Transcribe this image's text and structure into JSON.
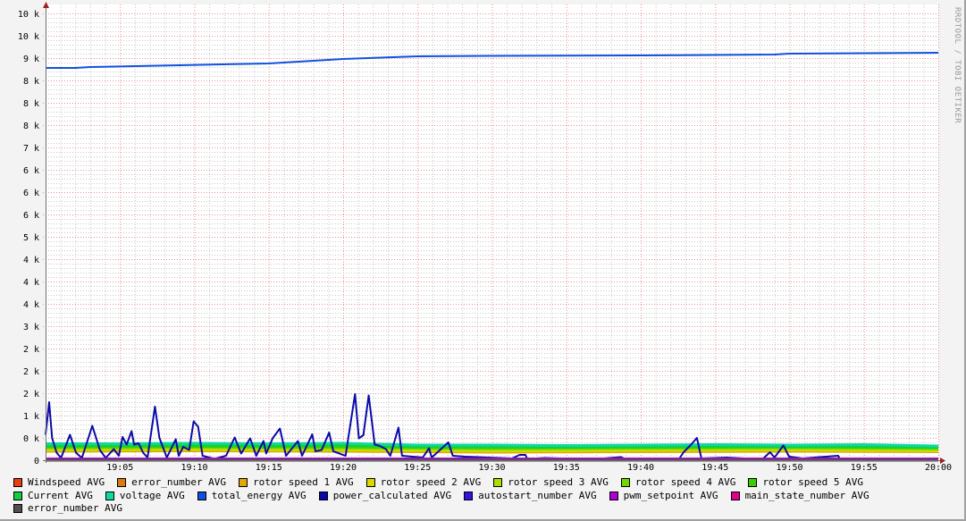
{
  "chart_data": {
    "type": "line",
    "title": "",
    "watermark": "RRDTOOL / TOBI OETIKER",
    "xlabel": "",
    "ylabel": "",
    "x_unit": "minutes after 19:00",
    "xlim": [
      0,
      60
    ],
    "ylim": [
      0,
      10000
    ],
    "grid": true,
    "legend_placement": "bottom",
    "x_ticks": [
      {
        "min": 5,
        "label": "19:05"
      },
      {
        "min": 10,
        "label": "19:10"
      },
      {
        "min": 15,
        "label": "19:15"
      },
      {
        "min": 20,
        "label": "19:20"
      },
      {
        "min": 25,
        "label": "19:25"
      },
      {
        "min": 30,
        "label": "19:30"
      },
      {
        "min": 35,
        "label": "19:35"
      },
      {
        "min": 40,
        "label": "19:40"
      },
      {
        "min": 45,
        "label": "19:45"
      },
      {
        "min": 50,
        "label": "19:50"
      },
      {
        "min": 55,
        "label": "19:55"
      },
      {
        "min": 60,
        "label": "20:00"
      }
    ],
    "y_ticks": [
      {
        "v": 0,
        "label": "0"
      },
      {
        "v": 500,
        "label": "0 k"
      },
      {
        "v": 1000,
        "label": "1 k"
      },
      {
        "v": 1500,
        "label": "2 k"
      },
      {
        "v": 2000,
        "label": "2 k"
      },
      {
        "v": 2500,
        "label": "2 k"
      },
      {
        "v": 3000,
        "label": "3 k"
      },
      {
        "v": 3500,
        "label": "4 k"
      },
      {
        "v": 4000,
        "label": "4 k"
      },
      {
        "v": 4500,
        "label": "4 k"
      },
      {
        "v": 5000,
        "label": "5 k"
      },
      {
        "v": 5500,
        "label": "6 k"
      },
      {
        "v": 6000,
        "label": "6 k"
      },
      {
        "v": 6500,
        "label": "6 k"
      },
      {
        "v": 7000,
        "label": "7 k"
      },
      {
        "v": 7500,
        "label": "8 k"
      },
      {
        "v": 8000,
        "label": "8 k"
      },
      {
        "v": 8500,
        "label": "8 k"
      },
      {
        "v": 9000,
        "label": "9 k"
      },
      {
        "v": 9500,
        "label": "10 k"
      },
      {
        "v": 10000,
        "label": "10 k"
      }
    ],
    "series": [
      {
        "name": "Windspeed AVG",
        "color": "#e8400c",
        "points": [
          [
            0,
            10
          ],
          [
            60,
            10
          ]
        ]
      },
      {
        "name": "error_number AVG",
        "color": "#d87a10",
        "points": [
          [
            0,
            0
          ],
          [
            60,
            0
          ]
        ]
      },
      {
        "name": "rotor speed 1 AVG",
        "color": "#e0a800",
        "points": [
          [
            0,
            200
          ],
          [
            10,
            210
          ],
          [
            20,
            200
          ],
          [
            30,
            180
          ],
          [
            40,
            190
          ],
          [
            50,
            200
          ],
          [
            60,
            190
          ]
        ]
      },
      {
        "name": "rotor speed 2 AVG",
        "color": "#d8d800",
        "points": [
          [
            0,
            230
          ],
          [
            10,
            240
          ],
          [
            20,
            230
          ],
          [
            30,
            210
          ],
          [
            40,
            220
          ],
          [
            50,
            230
          ],
          [
            60,
            210
          ]
        ]
      },
      {
        "name": "rotor speed 3 AVG",
        "color": "#a8e000",
        "points": [
          [
            0,
            260
          ],
          [
            10,
            270
          ],
          [
            20,
            260
          ],
          [
            30,
            240
          ],
          [
            40,
            250
          ],
          [
            50,
            260
          ],
          [
            60,
            240
          ]
        ]
      },
      {
        "name": "rotor speed 4 AVG",
        "color": "#70d800",
        "points": [
          [
            0,
            280
          ],
          [
            10,
            290
          ],
          [
            20,
            280
          ],
          [
            30,
            260
          ],
          [
            40,
            270
          ],
          [
            50,
            280
          ],
          [
            60,
            260
          ]
        ]
      },
      {
        "name": "rotor speed 5 AVG",
        "color": "#38d000",
        "points": [
          [
            0,
            300
          ],
          [
            10,
            310
          ],
          [
            20,
            300
          ],
          [
            30,
            280
          ],
          [
            40,
            290
          ],
          [
            50,
            300
          ],
          [
            60,
            280
          ]
        ]
      },
      {
        "name": "Current AVG",
        "color": "#10d040",
        "points": [
          [
            0,
            320
          ],
          [
            5,
            330
          ],
          [
            10,
            340
          ],
          [
            15,
            330
          ],
          [
            20,
            340
          ],
          [
            25,
            300
          ],
          [
            30,
            300
          ],
          [
            35,
            290
          ],
          [
            40,
            300
          ],
          [
            45,
            310
          ],
          [
            50,
            300
          ],
          [
            55,
            310
          ],
          [
            60,
            280
          ]
        ]
      },
      {
        "name": "voltage AVG",
        "color": "#10d8a0",
        "points": [
          [
            0,
            370
          ],
          [
            5,
            370
          ],
          [
            10,
            380
          ],
          [
            15,
            370
          ],
          [
            20,
            380
          ],
          [
            25,
            340
          ],
          [
            30,
            340
          ],
          [
            35,
            330
          ],
          [
            40,
            340
          ],
          [
            45,
            350
          ],
          [
            50,
            340
          ],
          [
            55,
            350
          ],
          [
            60,
            320
          ]
        ]
      },
      {
        "name": "total_energy AVG",
        "color": "#1050e0",
        "points": [
          [
            0,
            8780
          ],
          [
            2,
            8780
          ],
          [
            3,
            8800
          ],
          [
            9,
            8840
          ],
          [
            15,
            8880
          ],
          [
            20,
            8980
          ],
          [
            25,
            9040
          ],
          [
            30,
            9050
          ],
          [
            40,
            9060
          ],
          [
            49,
            9080
          ],
          [
            50,
            9100
          ],
          [
            60,
            9120
          ]
        ]
      },
      {
        "name": "power_calculated AVG",
        "color": "#0a0aa8",
        "points": [
          [
            0,
            570
          ],
          [
            0.24,
            1300
          ],
          [
            0.44,
            500
          ],
          [
            0.74,
            170
          ],
          [
            1.04,
            50
          ],
          [
            1.64,
            570
          ],
          [
            2.04,
            170
          ],
          [
            2.44,
            50
          ],
          [
            3.14,
            770
          ],
          [
            3.65,
            230
          ],
          [
            4.04,
            50
          ],
          [
            4.58,
            250
          ],
          [
            4.92,
            100
          ],
          [
            5.18,
            520
          ],
          [
            5.45,
            350
          ],
          [
            5.78,
            650
          ],
          [
            5.95,
            350
          ],
          [
            6.25,
            380
          ],
          [
            6.55,
            170
          ],
          [
            6.85,
            60
          ],
          [
            7.35,
            1200
          ],
          [
            7.65,
            500
          ],
          [
            8.15,
            60
          ],
          [
            8.75,
            470
          ],
          [
            8.95,
            100
          ],
          [
            9.25,
            300
          ],
          [
            9.65,
            230
          ],
          [
            9.95,
            870
          ],
          [
            10.25,
            750
          ],
          [
            10.55,
            100
          ],
          [
            11.35,
            30
          ],
          [
            12.13,
            100
          ],
          [
            12.71,
            510
          ],
          [
            13.15,
            150
          ],
          [
            13.75,
            490
          ],
          [
            14.16,
            100
          ],
          [
            14.65,
            430
          ],
          [
            14.83,
            150
          ],
          [
            15.26,
            490
          ],
          [
            15.75,
            710
          ],
          [
            16.16,
            100
          ],
          [
            16.96,
            430
          ],
          [
            17.24,
            100
          ],
          [
            17.92,
            580
          ],
          [
            18.14,
            200
          ],
          [
            18.56,
            230
          ],
          [
            19.06,
            620
          ],
          [
            19.34,
            200
          ],
          [
            20.16,
            100
          ],
          [
            20.8,
            1480
          ],
          [
            21.06,
            490
          ],
          [
            21.36,
            560
          ],
          [
            21.72,
            1450
          ],
          [
            22.12,
            350
          ],
          [
            22.46,
            320
          ],
          [
            22.87,
            250
          ],
          [
            23.17,
            100
          ],
          [
            23.72,
            730
          ],
          [
            23.96,
            100
          ],
          [
            25.35,
            60
          ],
          [
            25.77,
            270
          ],
          [
            25.95,
            60
          ],
          [
            27.07,
            400
          ],
          [
            27.37,
            100
          ],
          [
            28.17,
            80
          ],
          [
            31.35,
            40
          ],
          [
            31.87,
            120
          ],
          [
            32.25,
            120
          ],
          [
            32.37,
            30
          ],
          [
            33.57,
            50
          ],
          [
            36.76,
            20
          ],
          [
            38.68,
            70
          ],
          [
            39,
            20
          ],
          [
            42.58,
            30
          ],
          [
            42.88,
            180
          ],
          [
            43.36,
            340
          ],
          [
            43.78,
            500
          ],
          [
            44.08,
            40
          ],
          [
            45.77,
            60
          ],
          [
            48.17,
            20
          ],
          [
            48.69,
            180
          ],
          [
            48.99,
            60
          ],
          [
            49.59,
            330
          ],
          [
            49.97,
            80
          ],
          [
            50.87,
            40
          ],
          [
            53.27,
            100
          ],
          [
            53.39,
            30
          ],
          [
            58.68,
            30
          ],
          [
            60,
            30
          ]
        ]
      },
      {
        "name": "autostart_number AVG",
        "color": "#3a10e0",
        "points": [
          [
            0,
            0
          ],
          [
            60,
            0
          ]
        ]
      },
      {
        "name": "pwm_setpoint AVG",
        "color": "#b000d8",
        "points": [
          [
            0,
            30
          ],
          [
            60,
            30
          ]
        ]
      },
      {
        "name": "main_state_number AVG",
        "color": "#e00090",
        "points": [
          [
            0,
            0
          ],
          [
            60,
            0
          ]
        ]
      },
      {
        "name": "error_number AVG",
        "color": "#505050",
        "points": [
          [
            0,
            0
          ],
          [
            60,
            0
          ]
        ]
      }
    ]
  }
}
